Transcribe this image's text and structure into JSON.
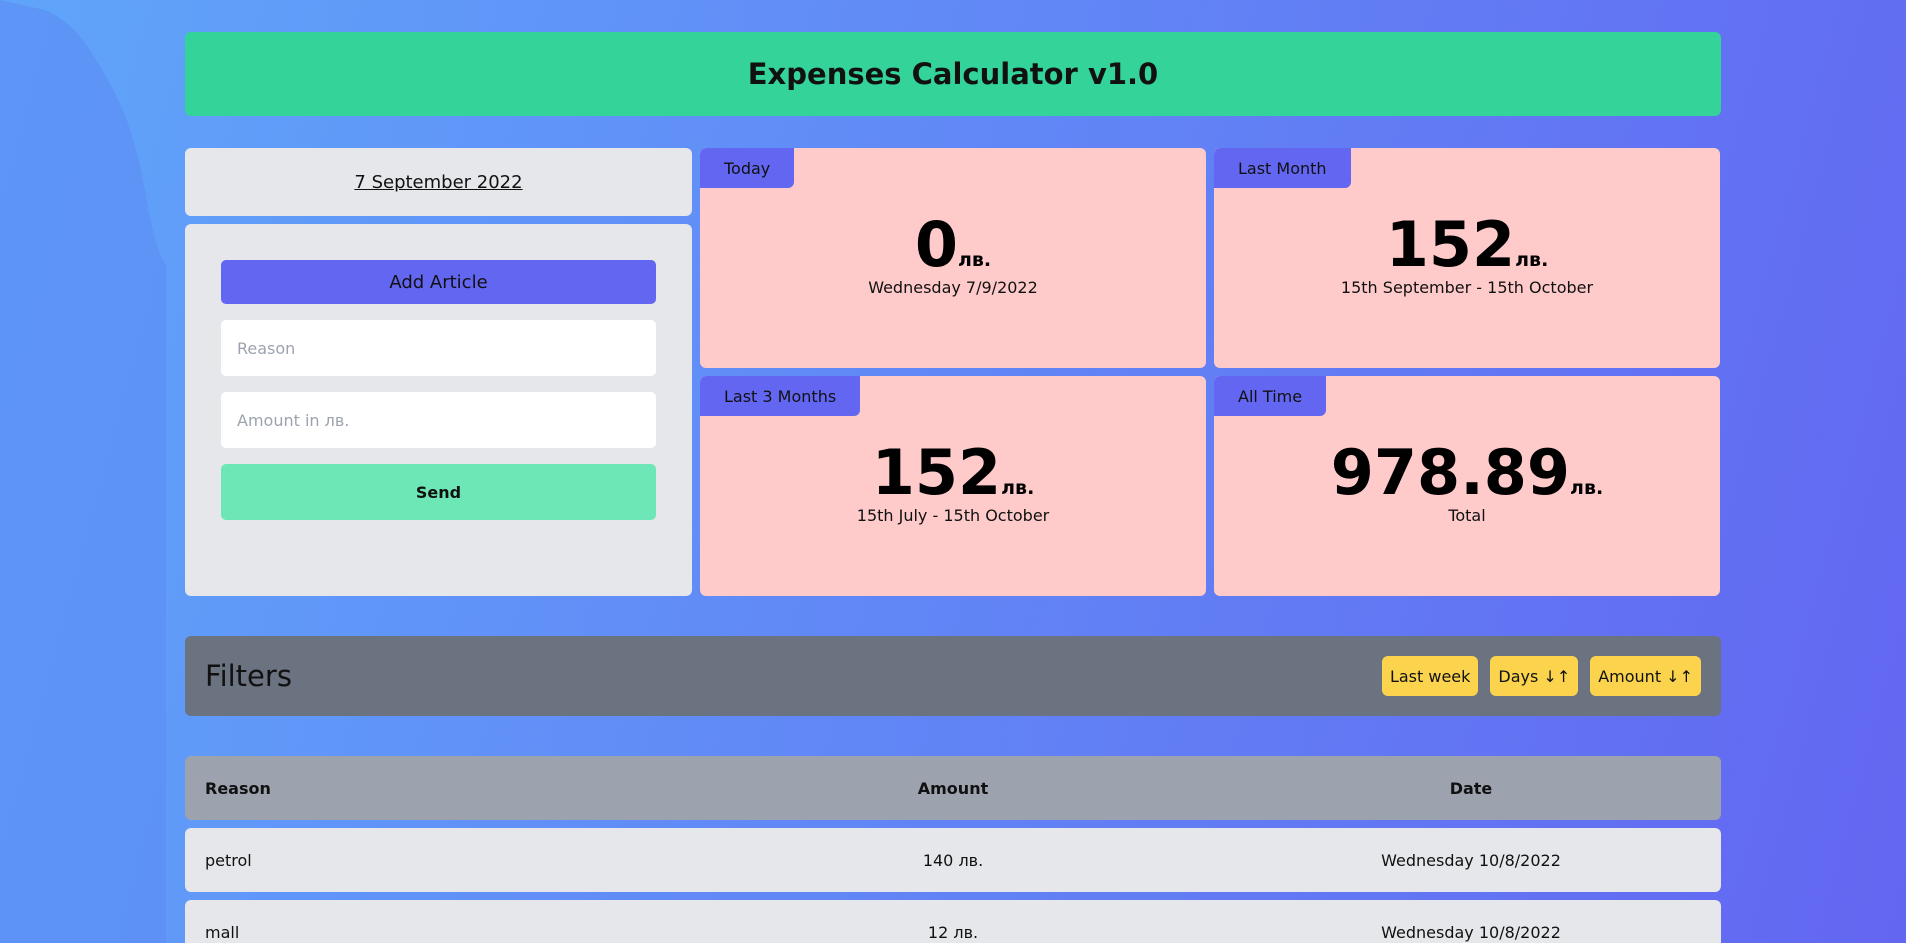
{
  "header": {
    "title": "Expenses Calculator v1.0"
  },
  "date": {
    "label": "7 September 2022"
  },
  "form": {
    "add_label": "Add Article",
    "reason_placeholder": "Reason",
    "amount_placeholder": "Amount in лв.",
    "send_label": "Send"
  },
  "stats": [
    {
      "tag": "Today",
      "value": "0",
      "unit": "лв.",
      "sub": "Wednesday 7/9/2022"
    },
    {
      "tag": "Last Month",
      "value": "152",
      "unit": "лв.",
      "sub": "15th September - 15th October"
    },
    {
      "tag": "Last 3 Months",
      "value": "152",
      "unit": "лв.",
      "sub": "15th July - 15th October"
    },
    {
      "tag": "All Time",
      "value": "978.89",
      "unit": "лв.",
      "sub": "Total"
    }
  ],
  "filters": {
    "title": "Filters",
    "buttons": [
      "Last week",
      "Days ↓↑",
      "Amount ↓↑"
    ]
  },
  "table": {
    "headers": [
      "Reason",
      "Amount",
      "Date"
    ],
    "rows": [
      {
        "reason": "petrol",
        "amount": "140 лв.",
        "date": "Wednesday 10/8/2022"
      },
      {
        "reason": "mall",
        "amount": "12 лв.",
        "date": "Wednesday 10/8/2022"
      }
    ]
  },
  "colors": {
    "header": "#34d399",
    "stat_card": "#fecaca",
    "tag": "#6366f1",
    "filter_button": "#fcd34d",
    "send_button": "#6ee7b7"
  }
}
